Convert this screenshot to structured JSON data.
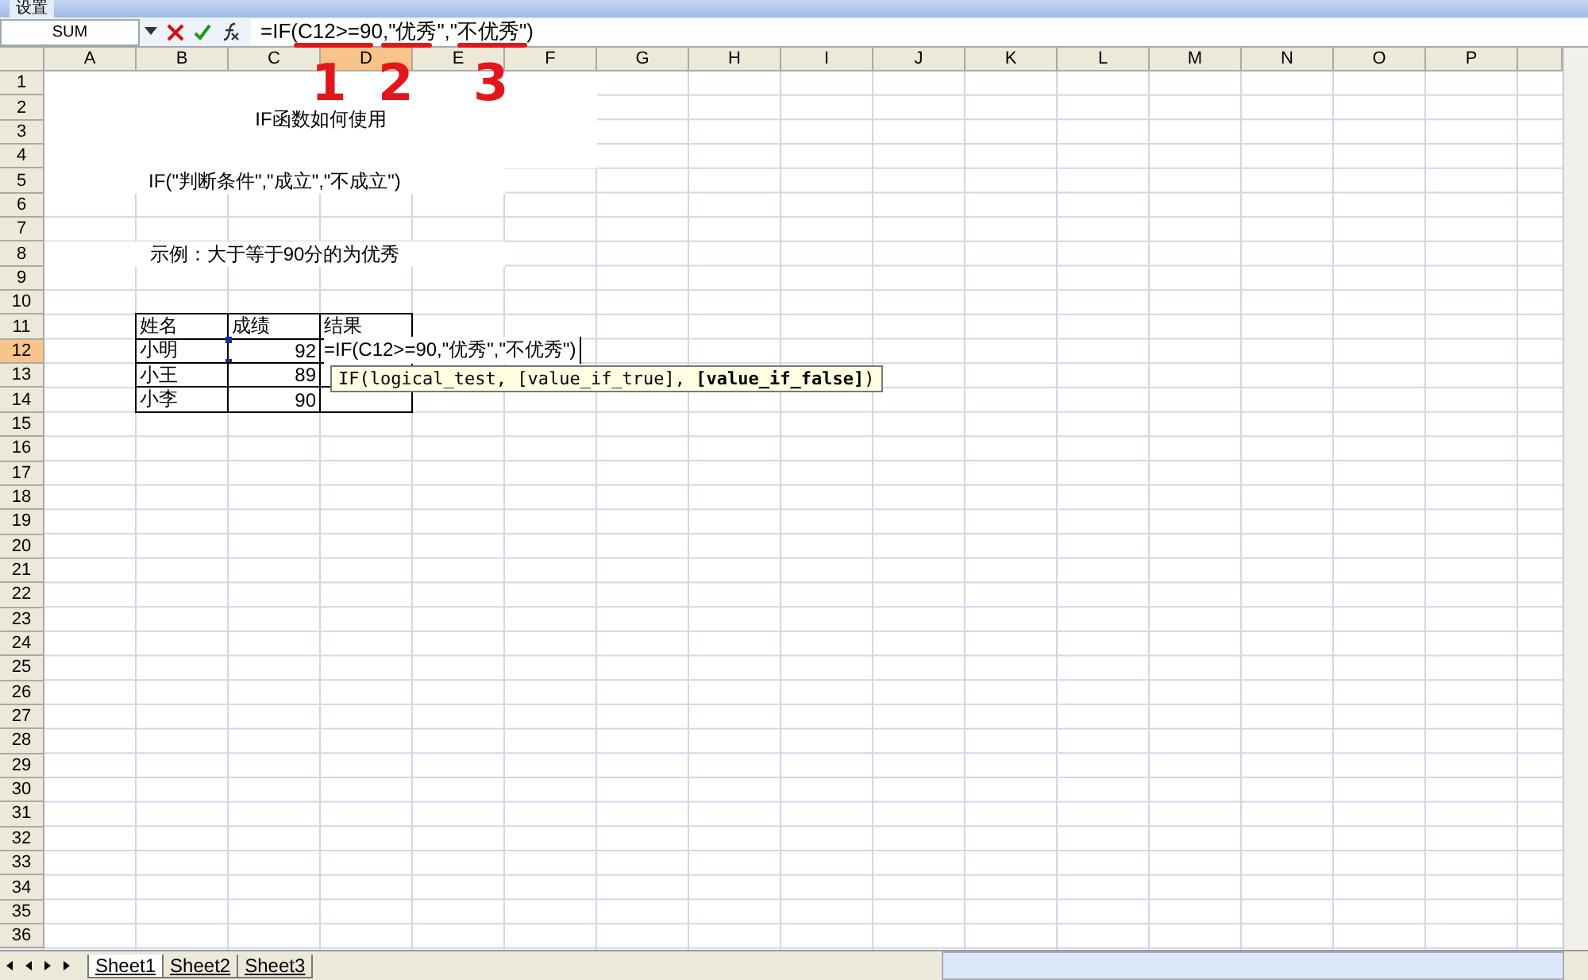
{
  "toolbar": {
    "label": "设置"
  },
  "formula_bar": {
    "name_box": "SUM",
    "formula": "=IF(C12>=90,\"优秀\",\"不优秀\")"
  },
  "annotations": [
    {
      "label": "1"
    },
    {
      "label": "2"
    },
    {
      "label": "3"
    }
  ],
  "columns": [
    {
      "label": "A",
      "selected": false
    },
    {
      "label": "B",
      "selected": false
    },
    {
      "label": "C",
      "selected": false
    },
    {
      "label": "D",
      "selected": true
    },
    {
      "label": "E",
      "selected": false
    },
    {
      "label": "F",
      "selected": false
    },
    {
      "label": "G",
      "selected": false
    },
    {
      "label": "H",
      "selected": false
    },
    {
      "label": "I",
      "selected": false
    },
    {
      "label": "J",
      "selected": false
    },
    {
      "label": "K",
      "selected": false
    },
    {
      "label": "L",
      "selected": false
    },
    {
      "label": "M",
      "selected": false
    },
    {
      "label": "N",
      "selected": false
    },
    {
      "label": "O",
      "selected": false
    },
    {
      "label": "P",
      "selected": false
    }
  ],
  "rows": [
    {
      "label": "1",
      "selected": false
    },
    {
      "label": "2",
      "selected": false
    },
    {
      "label": "3",
      "selected": false
    },
    {
      "label": "4",
      "selected": false
    },
    {
      "label": "5",
      "selected": false
    },
    {
      "label": "6",
      "selected": false
    },
    {
      "label": "7",
      "selected": false
    },
    {
      "label": "8",
      "selected": false
    },
    {
      "label": "9",
      "selected": false
    },
    {
      "label": "10",
      "selected": false
    },
    {
      "label": "11",
      "selected": false
    },
    {
      "label": "12",
      "selected": true
    },
    {
      "label": "13",
      "selected": false
    },
    {
      "label": "14",
      "selected": false
    },
    {
      "label": "15",
      "selected": false
    },
    {
      "label": "16",
      "selected": false
    },
    {
      "label": "17",
      "selected": false
    },
    {
      "label": "18",
      "selected": false
    },
    {
      "label": "19",
      "selected": false
    },
    {
      "label": "20",
      "selected": false
    },
    {
      "label": "21",
      "selected": false
    },
    {
      "label": "22",
      "selected": false
    },
    {
      "label": "23",
      "selected": false
    },
    {
      "label": "24",
      "selected": false
    },
    {
      "label": "25",
      "selected": false
    },
    {
      "label": "26",
      "selected": false
    },
    {
      "label": "27",
      "selected": false
    },
    {
      "label": "28",
      "selected": false
    },
    {
      "label": "29",
      "selected": false
    },
    {
      "label": "30",
      "selected": false
    },
    {
      "label": "31",
      "selected": false
    },
    {
      "label": "32",
      "selected": false
    },
    {
      "label": "33",
      "selected": false
    },
    {
      "label": "34",
      "selected": false
    },
    {
      "label": "35",
      "selected": false
    },
    {
      "label": "36",
      "selected": false
    }
  ],
  "headings": [
    {
      "text": "IF函数如何使用"
    },
    {
      "text": "IF(\"判断条件\",\"成立\",\"不成立\")"
    },
    {
      "text": "示例：大于等于90分的为优秀"
    }
  ],
  "table": {
    "columns": [
      "姓名",
      "成绩",
      "结果"
    ],
    "rows": [
      {
        "cells": [
          {
            "kind": "text",
            "text": "小明"
          },
          {
            "kind": "referenced",
            "text": "92"
          },
          {
            "kind": "editing",
            "text": "=IF(C12>=90,\"优秀\",\"不优秀\")"
          }
        ]
      },
      {
        "cells": [
          {
            "kind": "text",
            "text": "小王"
          },
          {
            "kind": "number",
            "text": "89"
          },
          {
            "kind": "blank"
          }
        ]
      },
      {
        "cells": [
          {
            "kind": "text",
            "text": "小李"
          },
          {
            "kind": "number",
            "text": "90"
          },
          {
            "kind": "blank"
          }
        ]
      }
    ]
  },
  "tooltip": {
    "text": "IF(logical_test, [value_if_true], **[value_if_false]**)"
  },
  "sheets": [
    {
      "label": "Sheet1",
      "selected": true
    },
    {
      "label": "Sheet2",
      "selected": false
    },
    {
      "label": "Sheet3",
      "selected": false
    }
  ]
}
